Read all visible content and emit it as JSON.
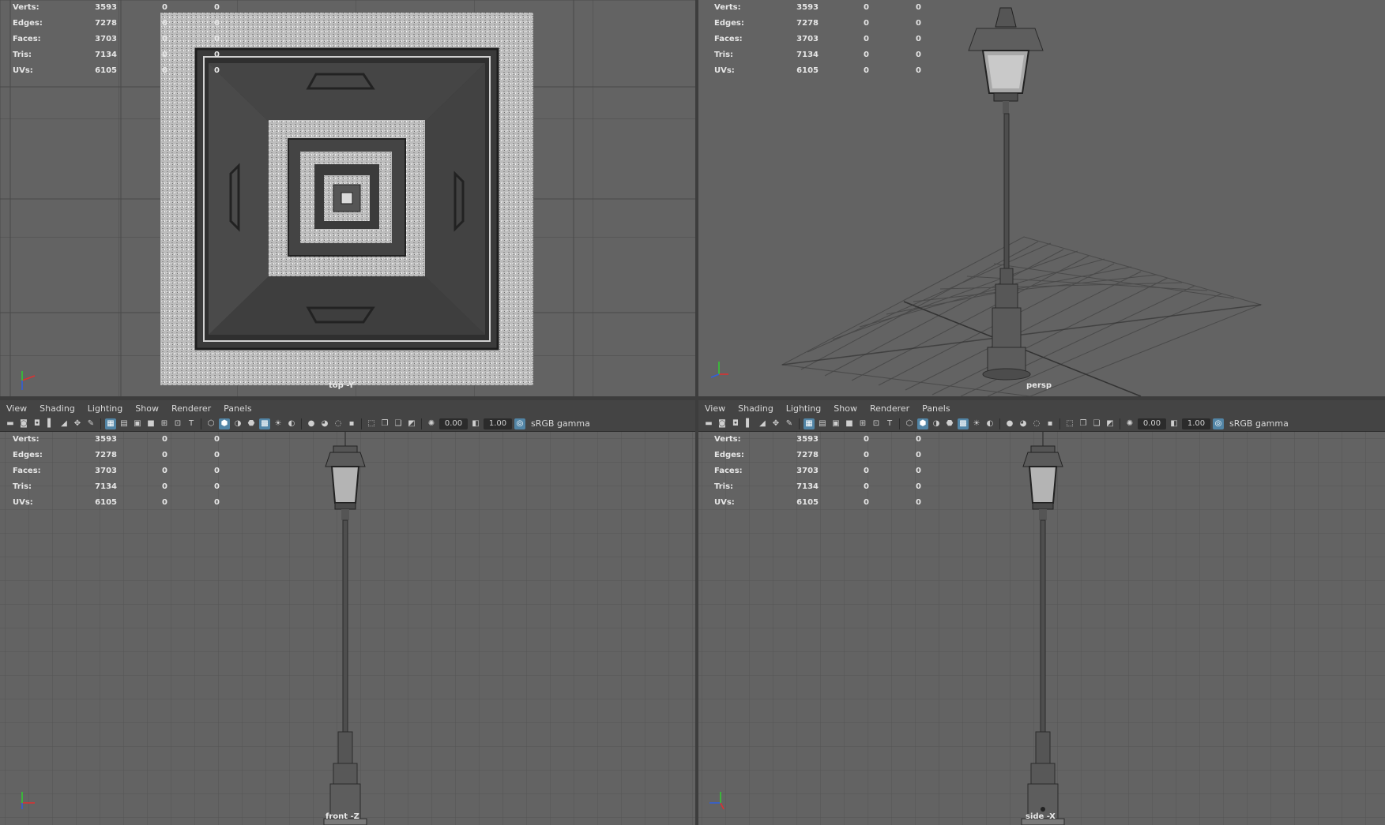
{
  "hud": {
    "labels": {
      "verts": "Verts:",
      "edges": "Edges:",
      "faces": "Faces:",
      "tris": "Tris:",
      "uvs": "UVs:"
    },
    "values": {
      "verts": [
        "3593",
        "0",
        "0"
      ],
      "edges": [
        "7278",
        "0",
        "0"
      ],
      "faces": [
        "3703",
        "0",
        "0"
      ],
      "tris": [
        "7134",
        "0",
        "0"
      ],
      "uvs": [
        "6105",
        "0",
        "0"
      ]
    }
  },
  "menu": {
    "view": "View",
    "shading": "Shading",
    "lighting": "Lighting",
    "show": "Show",
    "renderer": "Renderer",
    "panels": "Panels"
  },
  "toolbar": {
    "exposure": "0.00",
    "gamma": "1.00",
    "color_space": "sRGB gamma"
  },
  "cameras": {
    "top": "top -Y",
    "persp": "persp",
    "front": "front -Z",
    "side": "side -X"
  },
  "axis_letters": {
    "x": "x",
    "y": "y",
    "z": "z"
  },
  "colors": {
    "viewport_bg": "#636363",
    "grid_line": "#555555",
    "grid_major": "#3a3a3a",
    "panel_bar": "#444444",
    "accent_active": "#5285a6",
    "axis_x": "#e03030",
    "axis_y": "#30d030",
    "axis_z": "#3060e0"
  }
}
